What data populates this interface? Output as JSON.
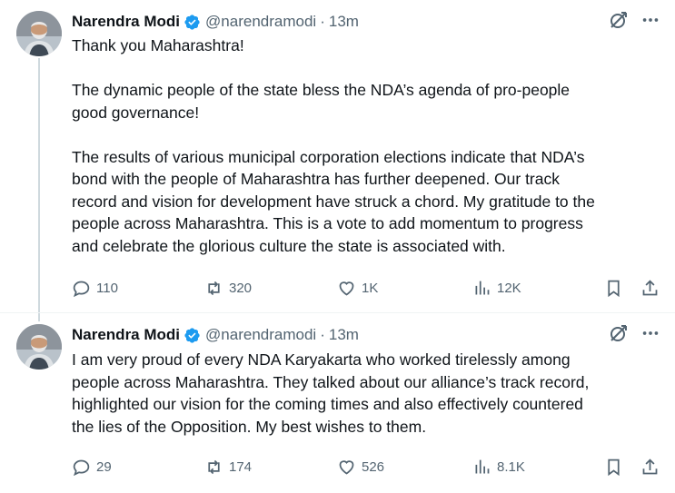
{
  "tweets": [
    {
      "name": "Narendra Modi",
      "handle": "@narendramodi",
      "separator": "·",
      "time": "13m",
      "text": "Thank you Maharashtra!\n\nThe dynamic people of the state bless the NDA’s agenda of pro-people\ngood governance!\n\nThe results of various municipal corporation elections indicate that NDA’s\nbond with the people of Maharashtra has further deepened. Our track\nrecord and vision for development have struck a chord. My gratitude to the\npeople across Maharashtra. This is a vote to add momentum to progress\nand celebrate the glorious culture the state is associated with.",
      "replies": "110",
      "reposts": "320",
      "likes": "1K",
      "views": "12K"
    },
    {
      "name": "Narendra Modi",
      "handle": "@narendramodi",
      "separator": "·",
      "time": "13m",
      "text": "I am very proud of every NDA Karyakarta who worked tirelessly among\npeople across Maharashtra. They talked about our alliance’s track record,\nhighlighted our vision for the coming times and also effectively countered\nthe lies of the Opposition. My best wishes to them.",
      "replies": "29",
      "reposts": "174",
      "likes": "526",
      "views": "8.1K"
    }
  ],
  "colors": {
    "verified": "#1d9bf0",
    "secondary_text": "#536471",
    "thread_line": "#cfd9de"
  },
  "icons": [
    "verified-badge-icon",
    "grok-icon",
    "more-icon",
    "reply-icon",
    "repost-icon",
    "like-icon",
    "views-icon",
    "bookmark-icon",
    "share-icon"
  ]
}
